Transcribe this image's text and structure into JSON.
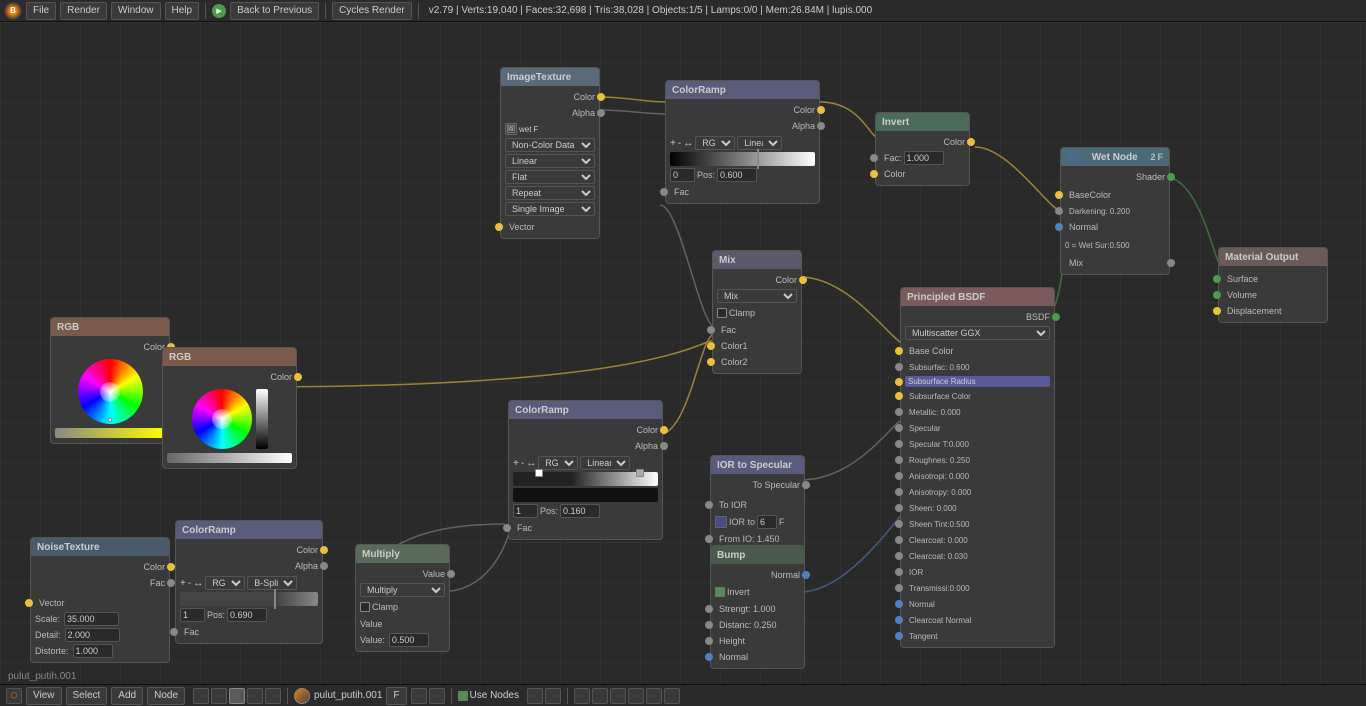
{
  "topbar": {
    "title": "Back to Previous",
    "render_engine": "Cycles Render",
    "version_info": "v2.79 | Verts:19,040 | Faces:32,698 | Tris:38,028 | Objects:1/5 | Lamps:0/0 | Mem:26.84M | lupis.000",
    "menus": [
      "File",
      "Render",
      "Window",
      "Help"
    ]
  },
  "bottombar": {
    "view_label": "View",
    "select_label": "Select",
    "add_label": "Add",
    "node_label": "Node",
    "file_name": "pulut_putih.001",
    "use_nodes_label": "Use Nodes"
  },
  "nodes": {
    "image_texture": {
      "title": "ImageTexture",
      "outputs": [
        "Color",
        "Alpha"
      ],
      "fields": [
        "wet",
        "Non-Color Data",
        "Linear",
        "Flat",
        "Repeat",
        "Single Image",
        "Vector"
      ]
    },
    "color_ramp_top": {
      "title": "ColorRamp",
      "outputs": [
        "Color",
        "Alpha"
      ],
      "pos": "0.600",
      "fac_label": "Fac"
    },
    "invert": {
      "title": "Invert",
      "fac_val": "1.000",
      "inputs": [
        "Fac",
        "Color"
      ],
      "output": "Color"
    },
    "mix": {
      "title": "Mix",
      "type": "Mix",
      "outputs": [
        "Color"
      ],
      "inputs": [
        "Fac",
        "Color1",
        "Color2"
      ],
      "clamp": false
    },
    "rgb_top": {
      "title": "RGB",
      "output": "Color"
    },
    "rgb_bottom": {
      "title": "RGB",
      "output": "Color"
    },
    "color_ramp_mid": {
      "title": "ColorRamp",
      "outputs": [
        "Color",
        "Alpha"
      ],
      "pos": "0.160",
      "fac_label": "Fac"
    },
    "noise_texture": {
      "title": "NoiseTexture",
      "inputs": [
        "Vector"
      ],
      "outputs": [
        "Color",
        "Fac"
      ],
      "scale": "35.000",
      "detail": "2.000",
      "distort": "1.000"
    },
    "color_ramp_bot": {
      "title": "ColorRamp",
      "outputs": [
        "Color",
        "Alpha"
      ],
      "pos": "0.690",
      "fac_label": "Fac"
    },
    "multiply": {
      "title": "Multiply",
      "type": "Multiply",
      "clamp": false,
      "value": "0.500"
    },
    "ior_to_specular": {
      "title": "IOR to Specular",
      "inputs": [
        "IOR to",
        "From IO:"
      ],
      "output": "To Specular",
      "ior_val": "6",
      "from_val": "1.450"
    },
    "bump": {
      "title": "Bump",
      "invert": true,
      "strength": "1.000",
      "distance": "0.250",
      "inputs": [
        "Height",
        "Normal"
      ],
      "output": "Normal"
    },
    "principled_bsdf": {
      "title": "Principled BSDF",
      "type": "Multiscatter GGX",
      "output": "BSDF",
      "fields": {
        "base_color": "Base Color",
        "subsurface": "Subsurfac: 0.600",
        "subsurface_radius": "Subsurface Radius",
        "subsurface_color": "Subsurface Color",
        "metallic": "Metallic:    0.000",
        "specular": "Specular",
        "specular_t": "Specular T:0.000",
        "roughness": "Roughnes: 0.250",
        "anisotropic": "Anisotropi: 0.000",
        "anisotropic_r": "Anisotropy: 0.000",
        "sheen": "Sheen:      0.000",
        "sheen_tint": "Sheen Tint:0.500",
        "clearcoat": "Clearcoat:  0.000",
        "clearcoat_r": "Clearcoat:  0.030",
        "ior": "IOR",
        "transmission": "Transmissi:0.000",
        "normal": "Normal",
        "clearcoat_n": "Clearcoat Normal",
        "tangent": "Tangent"
      }
    },
    "wet_node": {
      "title": "Wet Node",
      "node_num": "2",
      "inputs": [
        "BaseColor",
        "Darkening:",
        "Normal"
      ],
      "darkening_val": "0.200",
      "wet_sur_val": "0.500",
      "outputs": [
        "Shader",
        "Mix"
      ],
      "label": "0 = Wet Sur:0.500"
    },
    "material_output": {
      "title": "Material Output",
      "inputs": [
        "Surface",
        "Volume",
        "Displacement"
      ]
    }
  },
  "footer": {
    "filename": "pulut_putih.001"
  }
}
